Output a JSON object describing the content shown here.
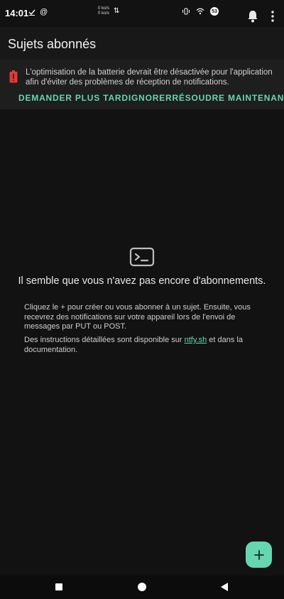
{
  "status_bar": {
    "time": "14:01",
    "net_up": "0 ko/s",
    "net_down": "0 ko/s",
    "battery_label": "53"
  },
  "app_bar": {
    "title": "Sujets abonnés"
  },
  "banner": {
    "text": "L'optimisation de la batterie devrait être désactivée pour l'application afin d'éviter des problèmes de réception de notifications.",
    "actions": [
      "DEMANDER PLUS TARD",
      "IGNORER",
      "RÉSOUDRE MAINTENANT"
    ]
  },
  "empty_state": {
    "title": "Il semble que vous n'avez pas encore d'abonnements.",
    "paragraph1": "Cliquez le + pour créer ou vous abonner à un sujet. Ensuite, vous recevrez des notifications sur votre appareil lors de l'envoi de messages par PUT ou POST.",
    "paragraph2_before": "Des instructions détaillées sont disponible sur ",
    "paragraph2_link": "ntfy.sh",
    "paragraph2_after": " et dans la documentation."
  },
  "fab": {
    "label": "+"
  },
  "colors": {
    "accent": "#65d6b0",
    "warning": "#e53935",
    "background": "#121212"
  },
  "icons": [
    "check-download-icon",
    "at-icon",
    "vibrate-icon",
    "wifi-icon",
    "bell-icon",
    "more-vert-icon",
    "battery-alert-icon",
    "terminal-icon",
    "plus-icon"
  ]
}
